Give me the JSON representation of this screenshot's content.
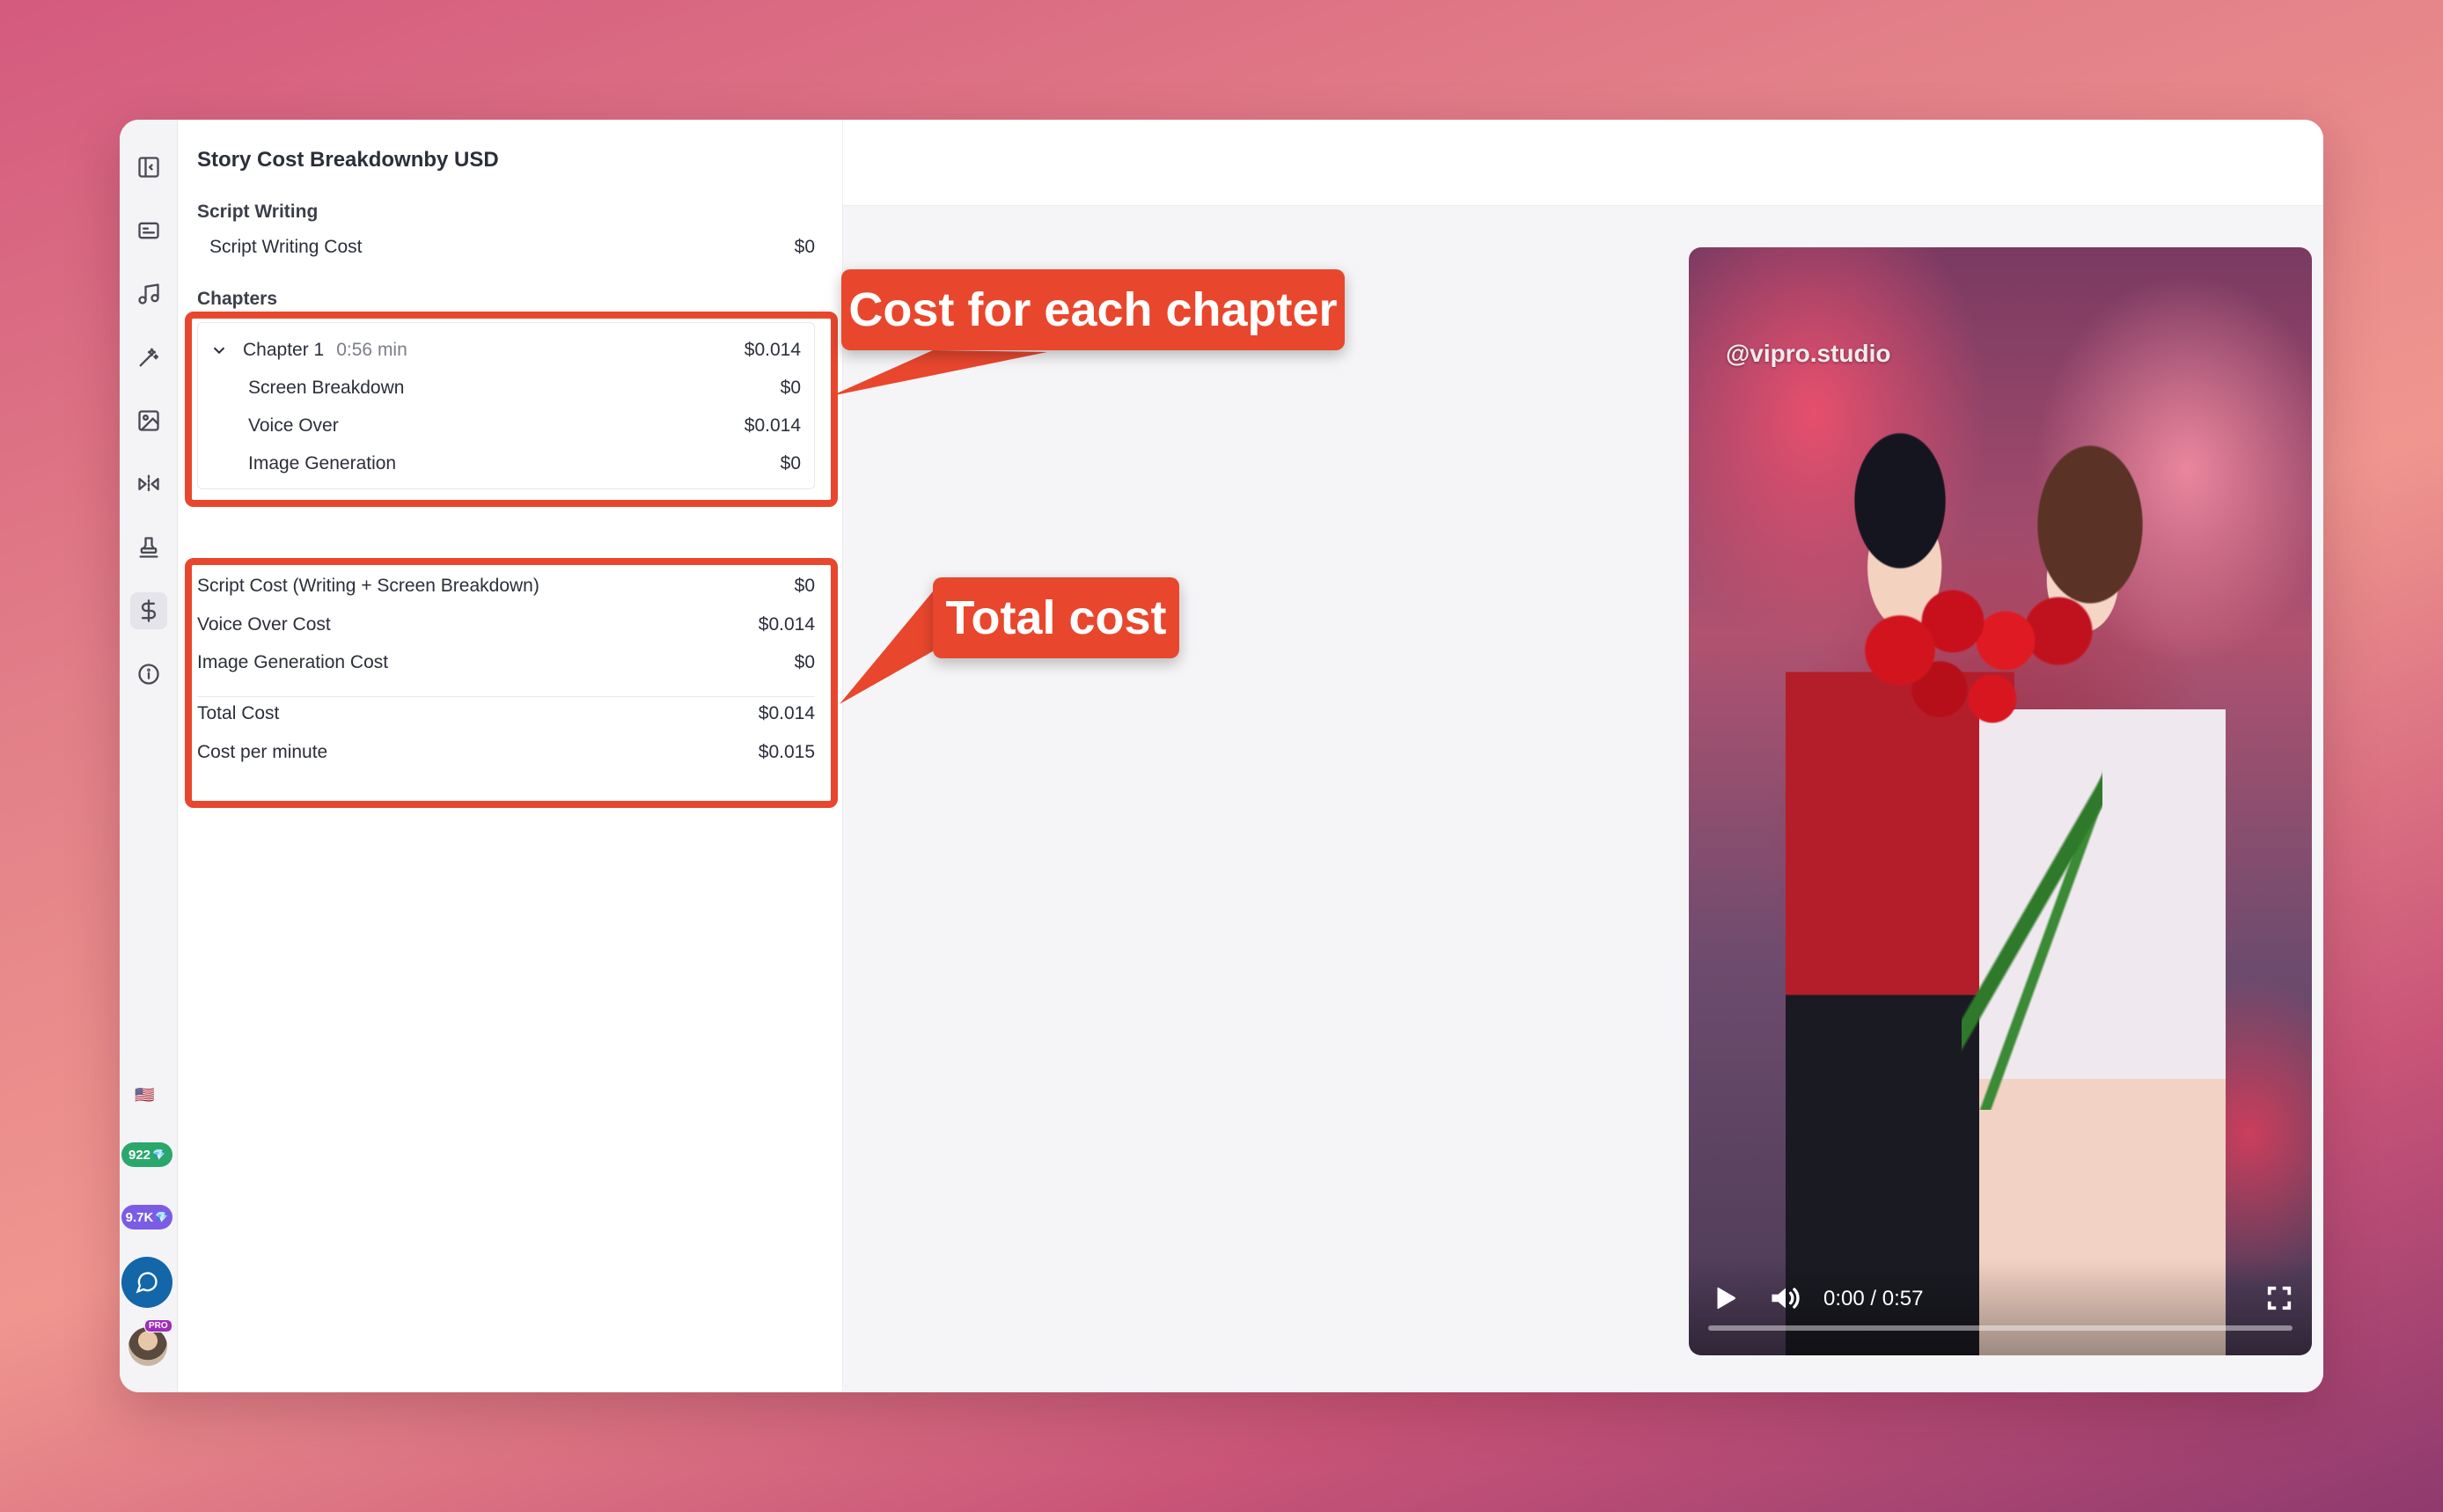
{
  "panel": {
    "title": "Story Cost Breakdownby USD",
    "script_writing": {
      "section": "Script Writing",
      "label": "Script Writing Cost",
      "value": "$0"
    },
    "chapters": {
      "section": "Chapters",
      "chapter": {
        "name": "Chapter 1",
        "duration": "0:56 min",
        "value": "$0.014",
        "items": [
          {
            "label": "Screen Breakdown",
            "value": "$0"
          },
          {
            "label": "Voice Over",
            "value": "$0.014"
          },
          {
            "label": "Image Generation",
            "value": "$0"
          }
        ]
      }
    },
    "summary": [
      {
        "label": "Script Cost (Writing + Screen Breakdown)",
        "value": "$0"
      },
      {
        "label": "Voice Over Cost",
        "value": "$0.014"
      },
      {
        "label": "Image Generation Cost",
        "value": "$0"
      }
    ],
    "totals": [
      {
        "label": "Total Cost",
        "value": "$0.014"
      },
      {
        "label": "Cost per minute",
        "value": "$0.015"
      }
    ]
  },
  "rail": {
    "flag": "🇺🇸",
    "credits_a": "922",
    "credits_b": "9.7K",
    "pro_badge": "PRO"
  },
  "video": {
    "watermark": "@vipro.studio",
    "time": "0:00 / 0:57",
    "progress": 0
  },
  "callouts": {
    "chapter": "Cost for each chapter",
    "total": "Total cost"
  },
  "colors": {
    "accent_red": "#e8472d",
    "credit_green": "#2aa86b",
    "credit_purple": "#7b5ce6",
    "chat_blue": "#1366a8"
  }
}
